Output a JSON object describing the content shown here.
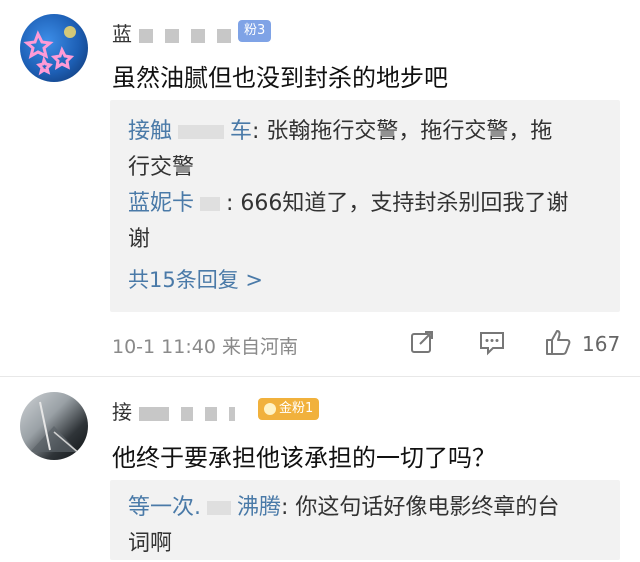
{
  "comments": [
    {
      "username": "蓝",
      "fan_badge": "粉3",
      "text": "虽然油腻但也没到封杀的地步吧",
      "replies": [
        {
          "user": "接触",
          "user_tail": "车",
          "text": ": 张翰拖行交警，拖行交警，拖",
          "text2": "行交警"
        },
        {
          "user": "蓝妮卡",
          "text": ": 666知道了，支持封杀别回我了谢",
          "text2": "谢"
        }
      ],
      "more_replies": "共15条回复 >",
      "time": "10-1 11:40 来自河南",
      "like_count": "167",
      "icons": [
        "share-icon",
        "comment-icon",
        "like-icon"
      ]
    },
    {
      "username": "接",
      "fan_badge": "金粉1",
      "text": "他终于要承担他该承担的一切了吗？",
      "replies": [
        {
          "user": "等一次.",
          "user_tail": "沸腾",
          "text": ": 你这句话好像电影终章的台",
          "text2": "词啊"
        }
      ]
    }
  ],
  "colors": {
    "reply_user": "#4a7aa8",
    "fan_badge_blue": "#7fa3e6",
    "fan_badge_gold": "#f1b13c",
    "reply_bg": "#f2f2f2"
  }
}
